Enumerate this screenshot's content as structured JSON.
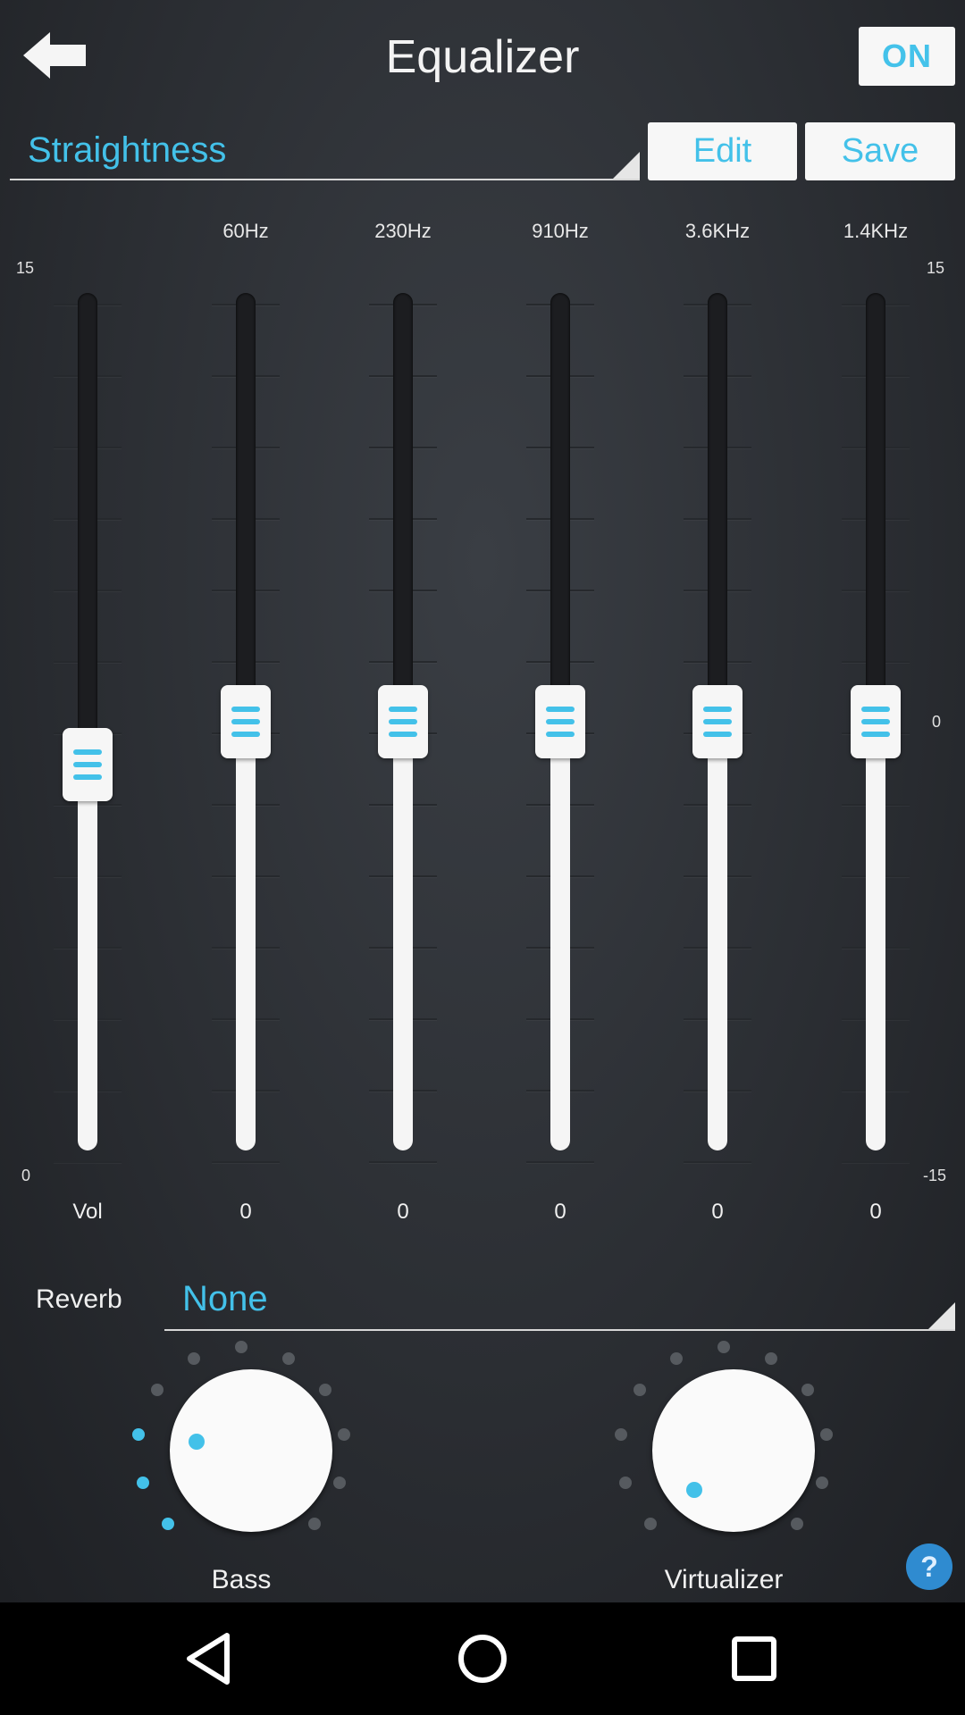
{
  "header": {
    "title": "Equalizer",
    "power_label": "ON"
  },
  "preset": {
    "value": "Straightness",
    "edit_label": "Edit",
    "save_label": "Save"
  },
  "scale": {
    "left_top": "15",
    "left_bottom": "0",
    "right_top": "15",
    "right_mid": "0",
    "right_bottom": "-15"
  },
  "sliders": [
    {
      "freq": "",
      "value_label": "Vol",
      "level": 0.45
    },
    {
      "freq": "60Hz",
      "value_label": "0",
      "level": 0.5
    },
    {
      "freq": "230Hz",
      "value_label": "0",
      "level": 0.5
    },
    {
      "freq": "910Hz",
      "value_label": "0",
      "level": 0.5
    },
    {
      "freq": "3.6KHz",
      "value_label": "0",
      "level": 0.5
    },
    {
      "freq": "1.4KHz",
      "value_label": "0",
      "level": 0.5
    }
  ],
  "reverb": {
    "label": "Reverb",
    "value": "None"
  },
  "knobs": [
    {
      "label": "Bass",
      "active_dots": 3,
      "total_dots": 11
    },
    {
      "label": "Virtualizer",
      "active_dots": 0,
      "total_dots": 11
    }
  ],
  "colors": {
    "accent": "#43c1e9",
    "background": "#2b2e33",
    "help": "#2f8bd0"
  },
  "icons": {
    "back": "back-arrow-icon",
    "help": "help-icon",
    "nav_back": "nav-back-icon",
    "nav_home": "nav-home-icon",
    "nav_recent": "nav-recent-icon"
  },
  "help_label": "?"
}
